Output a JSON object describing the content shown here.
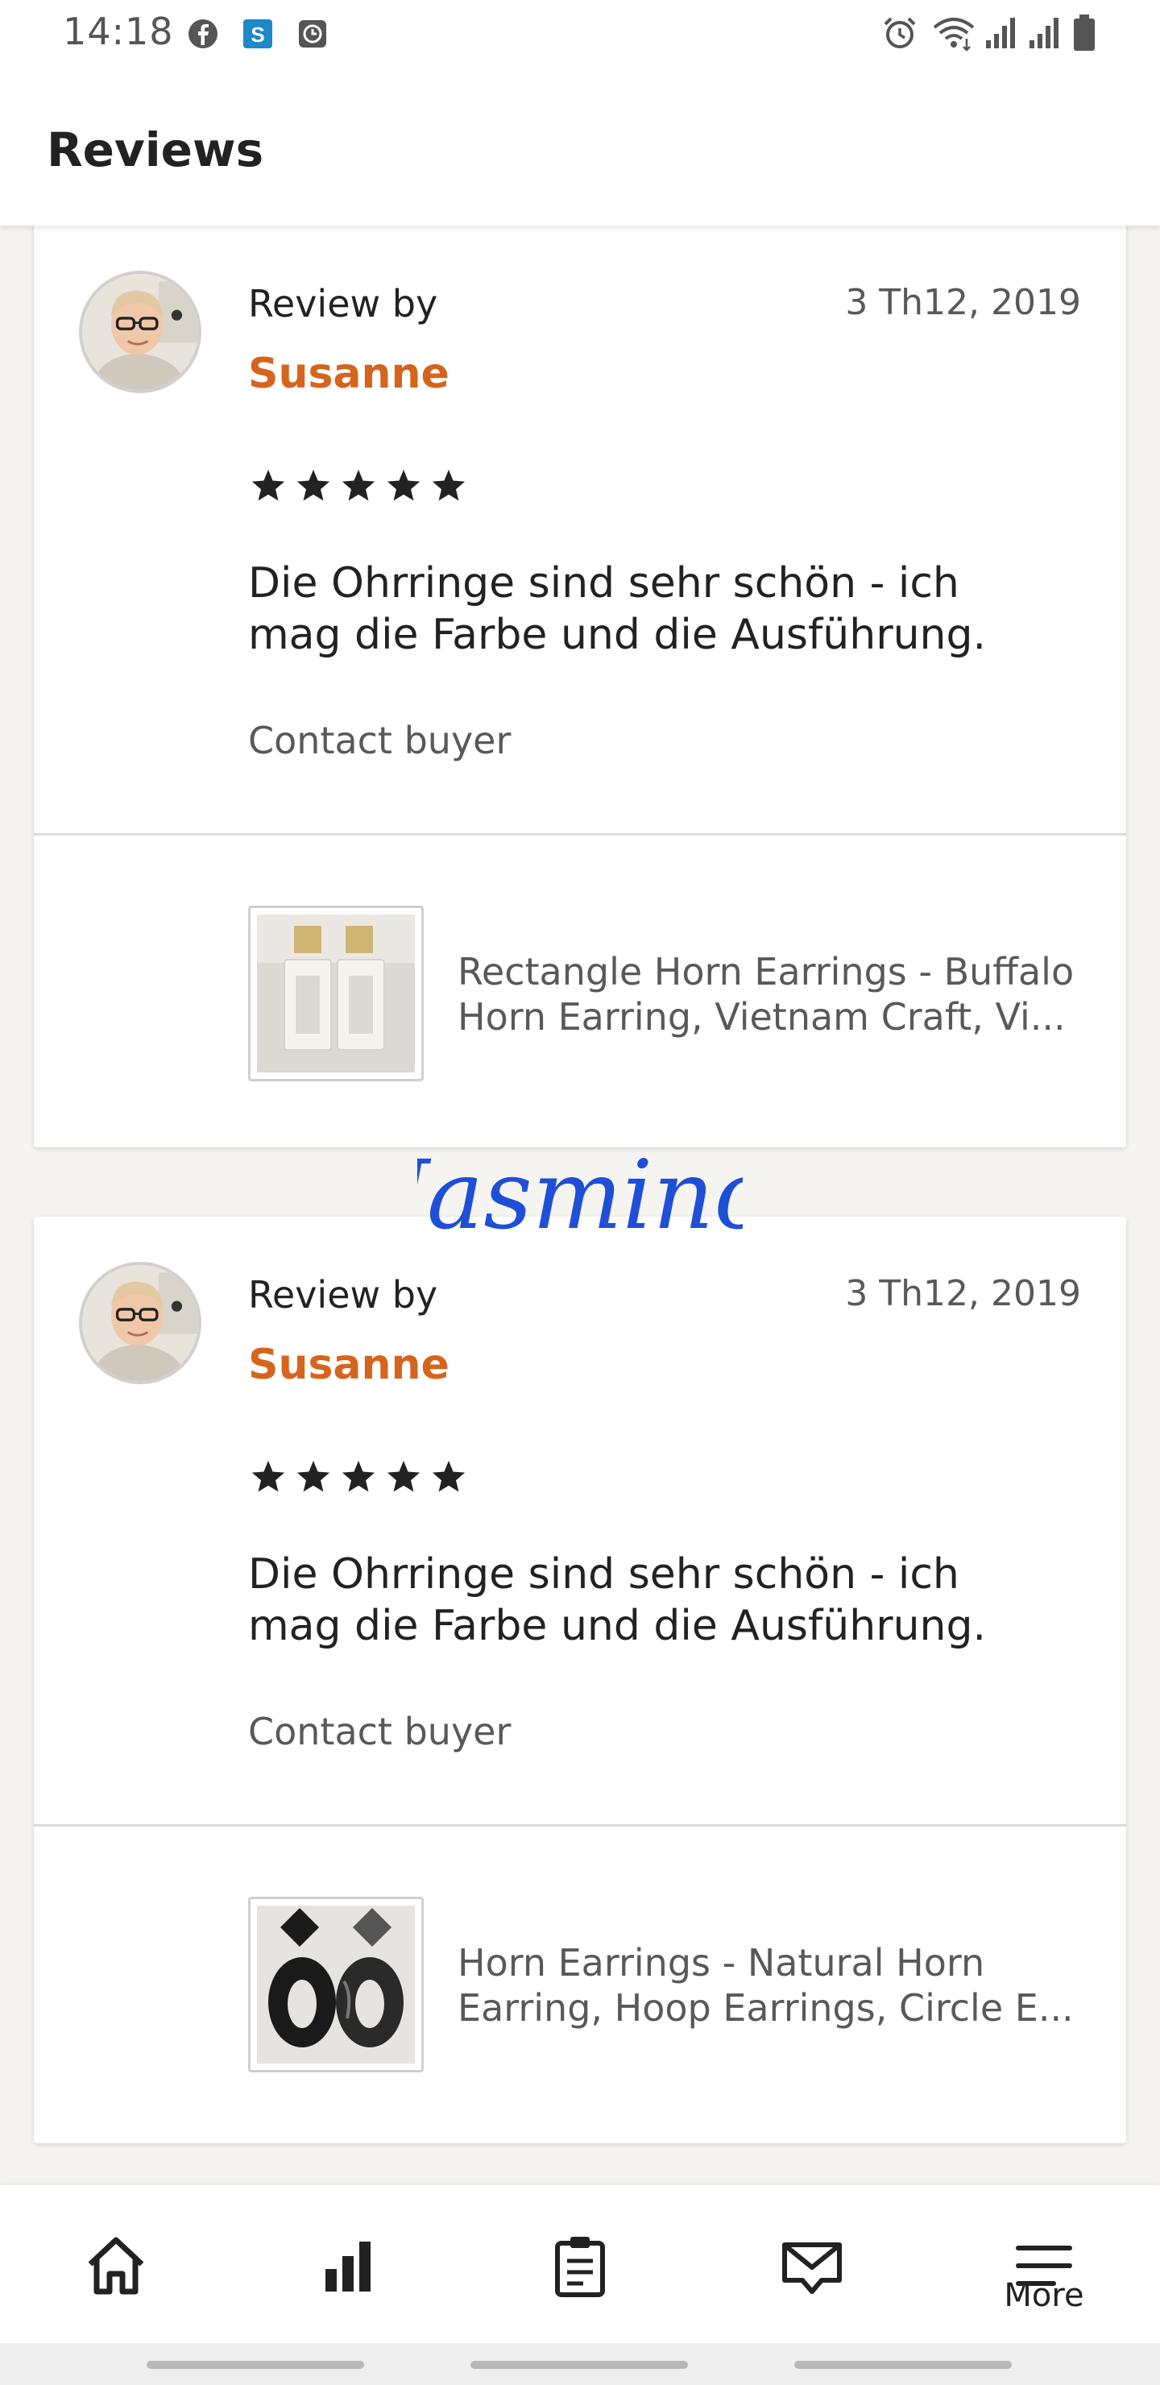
{
  "status_bar": {
    "time": "14:18",
    "left_icons": [
      "facebook-icon",
      "s-app-icon",
      "clock-app-icon"
    ],
    "right_icons": [
      "alarm-icon",
      "wifi-icon",
      "signal-icon",
      "signal-icon",
      "battery-icon"
    ]
  },
  "header": {
    "title": "Reviews"
  },
  "reviews": [
    {
      "review_by_label": "Review by",
      "reviewer": "Susanne",
      "date": "3 Th12, 2019",
      "rating": 5,
      "text": "Die Ohrringe sind sehr schön - ich mag die Farbe und die Ausführung.",
      "contact_label": "Contact buyer",
      "listing_title": "Rectangle Horn Earrings - Buffalo Horn Earring, Vietnam Craft, Vi...",
      "listing_image": "white-rectangle-horn-earrings"
    },
    {
      "review_by_label": "Review by",
      "reviewer": "Susanne",
      "date": "3 Th12, 2019",
      "rating": 5,
      "text": "Die Ohrringe sind sehr schön - ich mag die Farbe und die Ausführung.",
      "contact_label": "Contact buyer",
      "listing_title": "Horn Earrings - Natural Horn Earring, Hoop Earrings, Circle E...",
      "listing_image": "black-horn-hoop-earrings"
    }
  ],
  "watermark": {
    "text": "Jasmino",
    "color": "#1f4fd6"
  },
  "bottom_nav": {
    "items": [
      "home-icon",
      "stats-icon",
      "orders-icon",
      "messages-icon",
      "menu-icon"
    ],
    "more_label": "More"
  },
  "colors": {
    "accent": "#d5641c",
    "text": "#222222",
    "muted": "#595959",
    "background": "#f5f4f1"
  }
}
